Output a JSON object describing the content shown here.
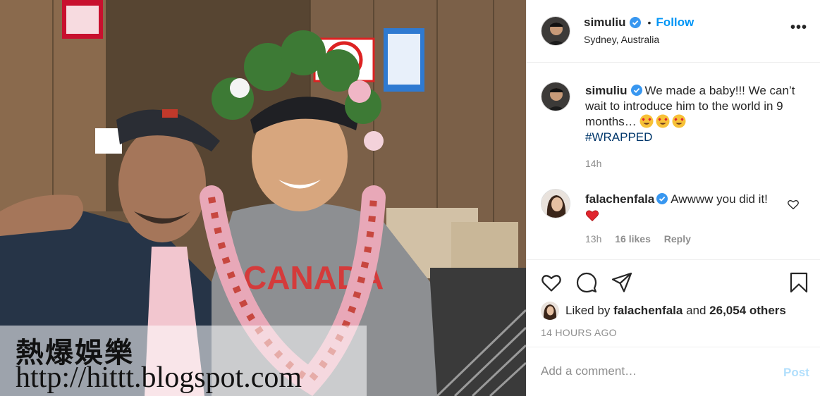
{
  "post": {
    "author": {
      "username": "simuliu",
      "location": "Sydney, Australia",
      "follow_label": "Follow",
      "separator": "•"
    },
    "more_label": "•••",
    "caption": {
      "username": "simuliu",
      "text": "We made a baby!!! We can’t wait to introduce him to the world in 9 months…",
      "emojis": [
        "heart-eyes",
        "heart-eyes",
        "heart-eyes"
      ],
      "hashtag": "#WRAPPED",
      "time": "14h"
    },
    "comments": [
      {
        "username": "falachenfala",
        "text": "Awwww you did it!",
        "emoji": "red-heart",
        "time": "13h",
        "likes": "16 likes",
        "reply_label": "Reply"
      }
    ],
    "liked_by": {
      "prefix": "Liked by",
      "user": "falachenfala",
      "joiner": "and",
      "others": "26,054 others"
    },
    "timestamp": "14 HOURS AGO",
    "add_comment": {
      "placeholder": "Add a comment…",
      "post_label": "Post"
    }
  },
  "watermark": {
    "line1": "熱爆娛樂",
    "line2": "http://hittt.blogspot.com"
  },
  "colors": {
    "accent": "#0095f6",
    "verified": "#3897f0",
    "muted": "#8e8e8e",
    "post_disabled": "#b2dffc",
    "hashtag": "#00376b"
  }
}
